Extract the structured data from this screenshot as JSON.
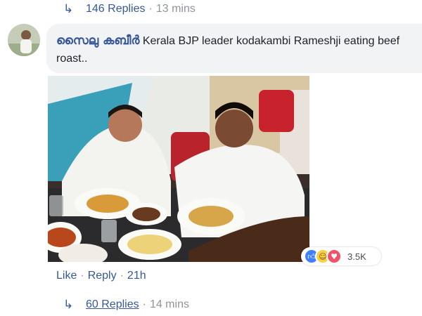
{
  "top_replies": {
    "count_label": "146 Replies",
    "time": "13 mins"
  },
  "comment": {
    "author": "സൈലു കബീർ",
    "text": "Kerala BJP leader kodakambi Rameshji eating beef roast.."
  },
  "reactions": {
    "icons": [
      "like-icon",
      "haha-icon",
      "love-icon"
    ],
    "count": "3.5K"
  },
  "actions": {
    "like": "Like",
    "reply": "Reply",
    "time": "21h"
  },
  "bottom_replies": {
    "count_label": "60 Replies",
    "time": "14 mins"
  },
  "colors": {
    "link": "#365899",
    "muted": "#90949c",
    "bubble": "#f2f3f5",
    "like": "#4080ff",
    "love": "#f25268",
    "haha": "#f7d049"
  }
}
